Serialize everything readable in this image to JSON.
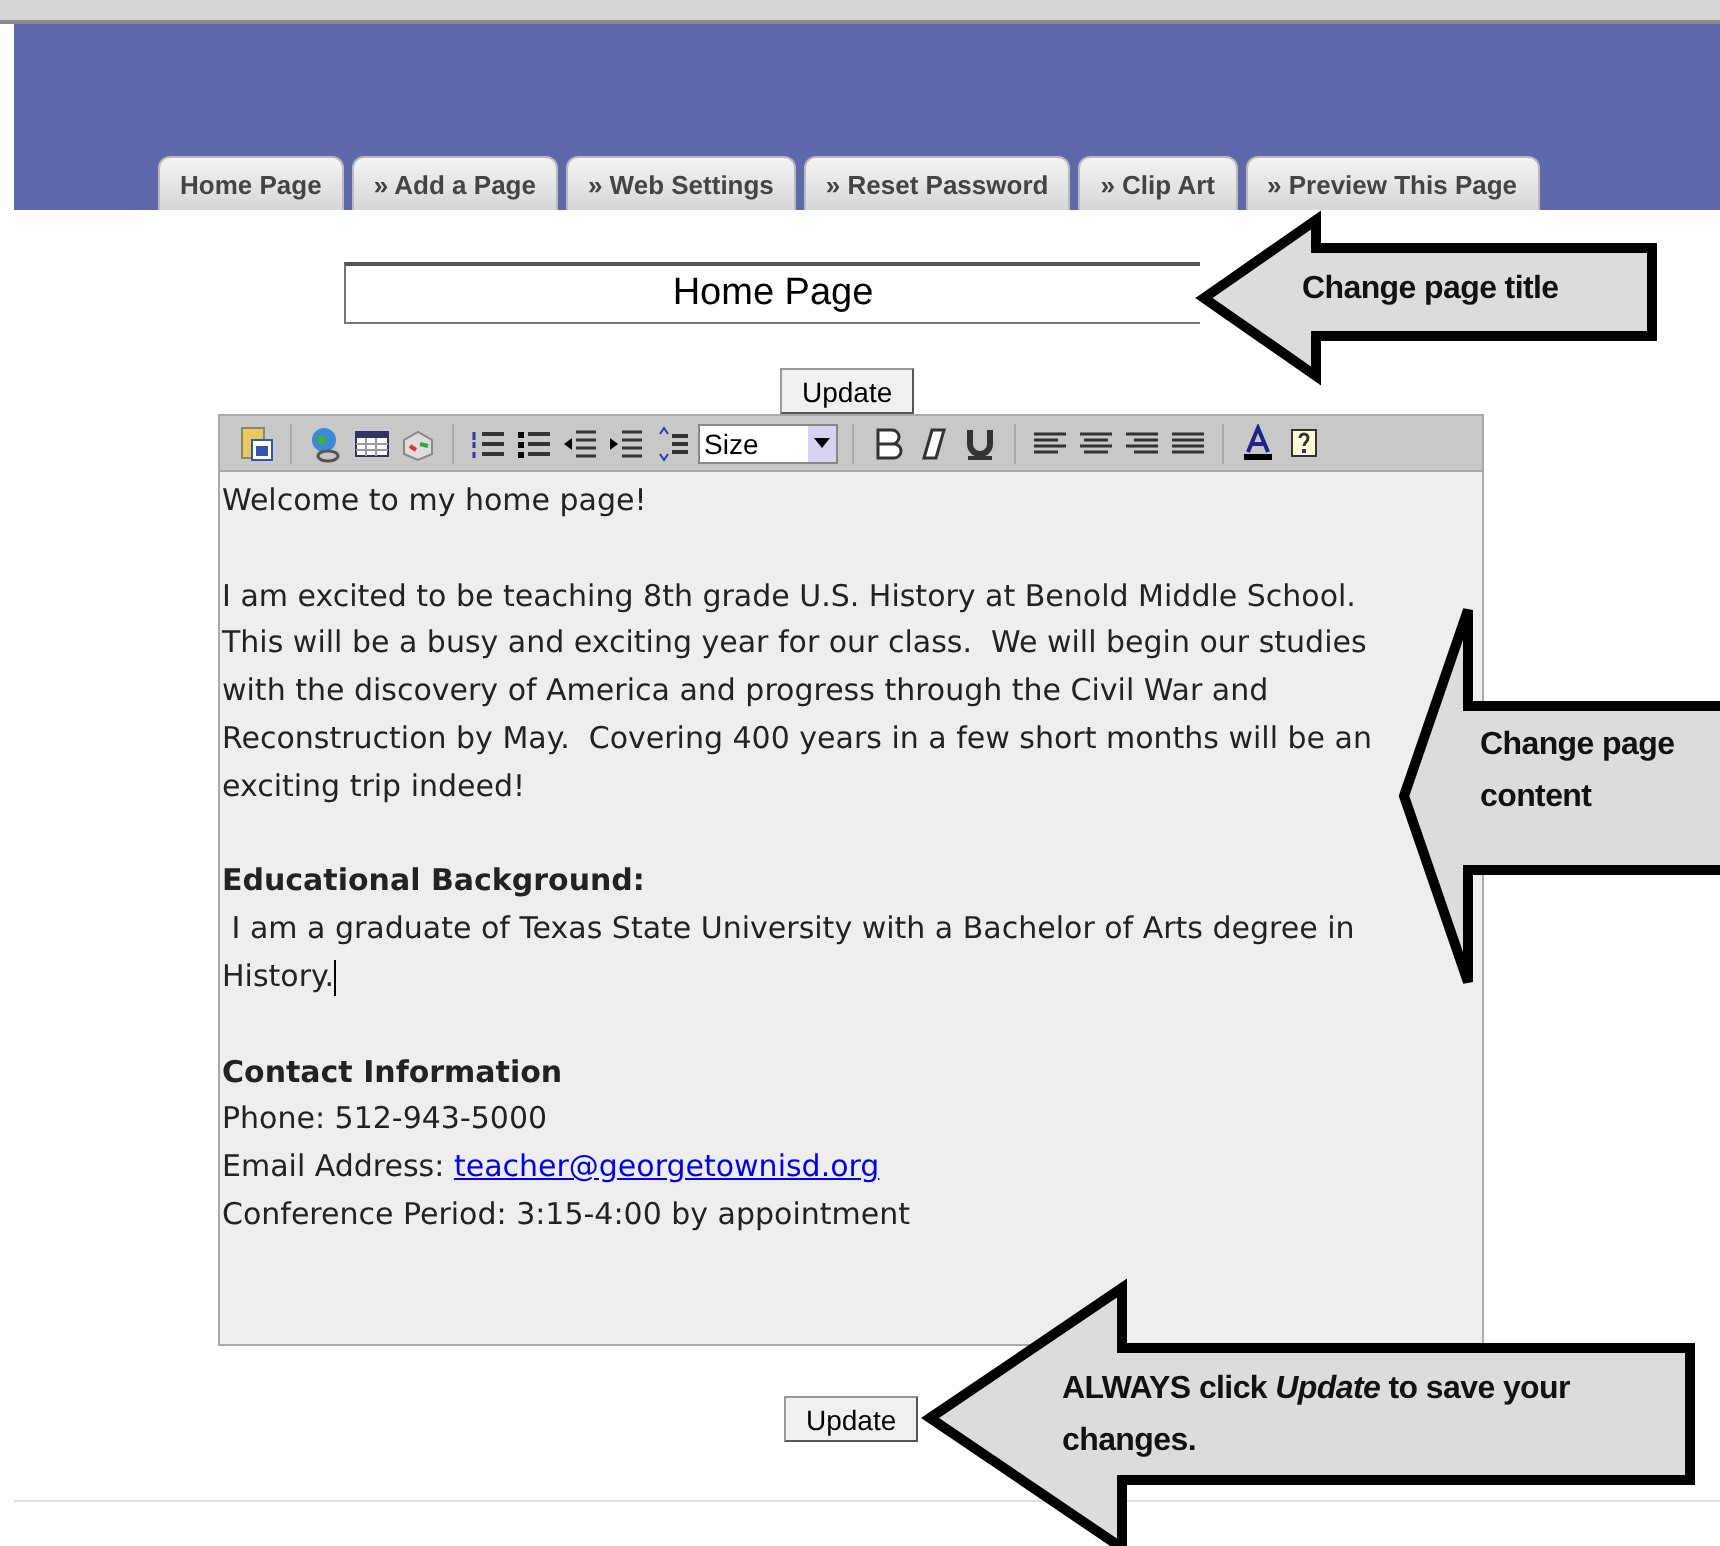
{
  "tabs": [
    {
      "label": "Home Page"
    },
    {
      "label": "» Add a Page"
    },
    {
      "label": "» Web Settings"
    },
    {
      "label": "» Reset Password"
    },
    {
      "label": "» Clip Art"
    },
    {
      "label": "» Preview This Page"
    }
  ],
  "title_field": {
    "value": "Home Page"
  },
  "update_buttons": [
    "Update",
    "Update"
  ],
  "toolbar": {
    "size_select": "Size"
  },
  "content": [
    {
      "kind": "paragraph",
      "lines": [
        "Welcome to my home page!"
      ]
    },
    {
      "kind": "paragraph",
      "lines": [
        "I am excited to be teaching 8th grade U.S. History at Benold Middle School.",
        "This will be a busy and exciting year for our class.  We will begin our studies",
        "with the discovery of America and progress through the Civil War and",
        "Reconstruction by May.  Covering 400 years in a few short months will be an",
        "exciting trip indeed!"
      ]
    },
    {
      "kind": "heading",
      "lines": [
        "Educational Background:"
      ]
    },
    {
      "kind": "paragraph",
      "lines": [
        " I am a graduate of Texas State University with a Bachelor of Arts degree in",
        "History."
      ],
      "cursor": true
    },
    {
      "kind": "heading",
      "lines": [
        "Contact Information"
      ]
    },
    {
      "kind": "line",
      "lines": [
        "Phone: 512-943-5000"
      ]
    },
    {
      "kind": "link_line",
      "label": "Email Address: ",
      "link": "teacher@georgetownisd.org"
    },
    {
      "kind": "line",
      "lines": [
        "Conference Period: 3:15-4:00 by appointment"
      ]
    }
  ],
  "callouts": [
    {
      "text": "Change page title"
    },
    {
      "text": "Change page content"
    },
    {
      "text": "ALWAYS click *Update* to save your changes."
    }
  ]
}
